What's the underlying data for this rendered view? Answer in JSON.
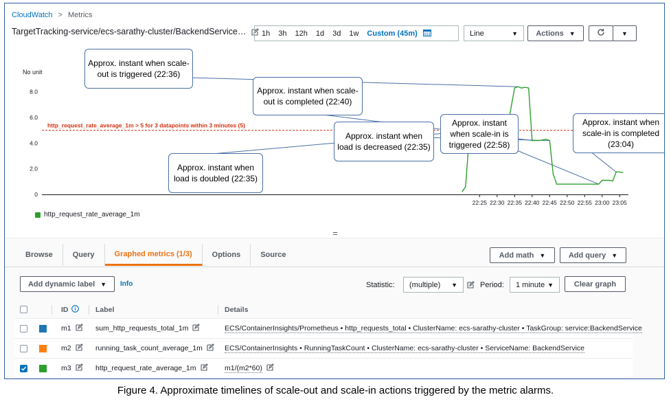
{
  "breadcrumb": {
    "root": "CloudWatch",
    "current": "Metrics"
  },
  "graph_title": "TargetTracking-service/ecs-sarathy-cluster/BackendService…",
  "time_range": {
    "options": [
      "1h",
      "3h",
      "12h",
      "1d",
      "3d",
      "1w"
    ],
    "custom": "Custom (45m)"
  },
  "chart_type_select": "Line",
  "actions_label": "Actions",
  "chart_data": {
    "type": "line",
    "ylabel": "No unit",
    "ylim": [
      0,
      9
    ],
    "y_ticks": [
      "0",
      "2.0",
      "4.0",
      "6.0",
      "8.0"
    ],
    "x_ticks": [
      "22:25",
      "22:30",
      "22:35",
      "22:40",
      "22:45",
      "22:50",
      "22:55",
      "23:00",
      "23:05"
    ],
    "series": [
      {
        "name": "http_request_rate_average_1m",
        "color": "#2ca02c",
        "x": [
          "22:20",
          "22:21",
          "22:22",
          "22:23",
          "22:24",
          "22:25",
          "22:26",
          "22:27",
          "22:28",
          "22:29",
          "22:30",
          "22:31",
          "22:32",
          "22:33",
          "22:34",
          "22:35",
          "22:36",
          "22:37",
          "22:38",
          "22:39",
          "22:40",
          "22:41",
          "22:42",
          "22:43",
          "22:44",
          "22:45",
          "22:46",
          "22:47",
          "22:48",
          "22:49",
          "22:50",
          "22:51",
          "22:52",
          "22:53",
          "22:54",
          "22:55",
          "22:56",
          "22:57",
          "22:58",
          "22:59",
          "23:00",
          "23:01",
          "23:02",
          "23:03",
          "23:04",
          "23:05",
          "23:06"
        ],
        "values": [
          0.2,
          0.6,
          4.3,
          4.25,
          4.2,
          4.2,
          4.15,
          4.2,
          4.2,
          4.2,
          4.25,
          4.2,
          4.3,
          5.2,
          6.8,
          8.3,
          8.4,
          8.3,
          8.35,
          8.3,
          4.2,
          4.2,
          4.2,
          4.25,
          4.3,
          4.2,
          1.6,
          0.8,
          0.8,
          0.8,
          0.8,
          0.8,
          0.8,
          0.8,
          0.8,
          0.8,
          0.8,
          0.8,
          0.8,
          0.8,
          1.1,
          1.1,
          1.1,
          1.05,
          1.75,
          1.75,
          1.7
        ]
      }
    ],
    "threshold": {
      "value": 5,
      "label": "http_request_rate_average_1m > 5 for 3 datapoints within 3 minutes (5)",
      "color": "#d13212"
    },
    "annotations": [
      {
        "text": "Approx. instant when scale-out is triggered (22:36)"
      },
      {
        "text": "Approx. instant when load is doubled (22:35)"
      },
      {
        "text": "Approx. instant when scale-out is completed (22:40)"
      },
      {
        "text": "Approx. instant when load is decreased (22:35)"
      },
      {
        "text": "Approx. instant when scale-in is triggered (22:58)"
      },
      {
        "text": "Approx. instant when scale-in is completed (23:04)"
      }
    ],
    "legend": "bottom-left",
    "grid": false
  },
  "tabs": [
    {
      "label": "Browse",
      "active": false
    },
    {
      "label": "Query",
      "active": false
    },
    {
      "label": "Graphed metrics (1/3)",
      "active": true
    },
    {
      "label": "Options",
      "active": false
    },
    {
      "label": "Source",
      "active": false
    }
  ],
  "add_math_label": "Add math",
  "add_query_label": "Add query",
  "add_dynamic_label": "Add dynamic label",
  "info_label": "Info",
  "statistic_label": "Statistic:",
  "statistic_value": "(multiple)",
  "period_label": "Period:",
  "period_value": "1 minute",
  "clear_graph_label": "Clear graph",
  "table": {
    "headers": {
      "id": "ID",
      "label": "Label",
      "details": "Details"
    },
    "rows": [
      {
        "id": "m1",
        "color": "#1f77b4",
        "checked": false,
        "label": "sum_http_requests_total_1m",
        "details": "ECS/ContainerInsights/Prometheus • http_requests_total • ClusterName: ecs-sarathy-cluster • TaskGroup: service:BackendService"
      },
      {
        "id": "m2",
        "color": "#ff7f0e",
        "checked": false,
        "label": "running_task_count_average_1m",
        "details": "ECS/ContainerInsights • RunningTaskCount • ClusterName: ecs-sarathy-cluster • ServiceName: BackendService"
      },
      {
        "id": "m3",
        "color": "#2ca02c",
        "checked": true,
        "label": "http_request_rate_average_1m",
        "details": "m1/(m2*60)"
      }
    ]
  },
  "caption": "Figure 4. Approximate timelines of scale-out and scale-in actions triggered by the metric alarms."
}
